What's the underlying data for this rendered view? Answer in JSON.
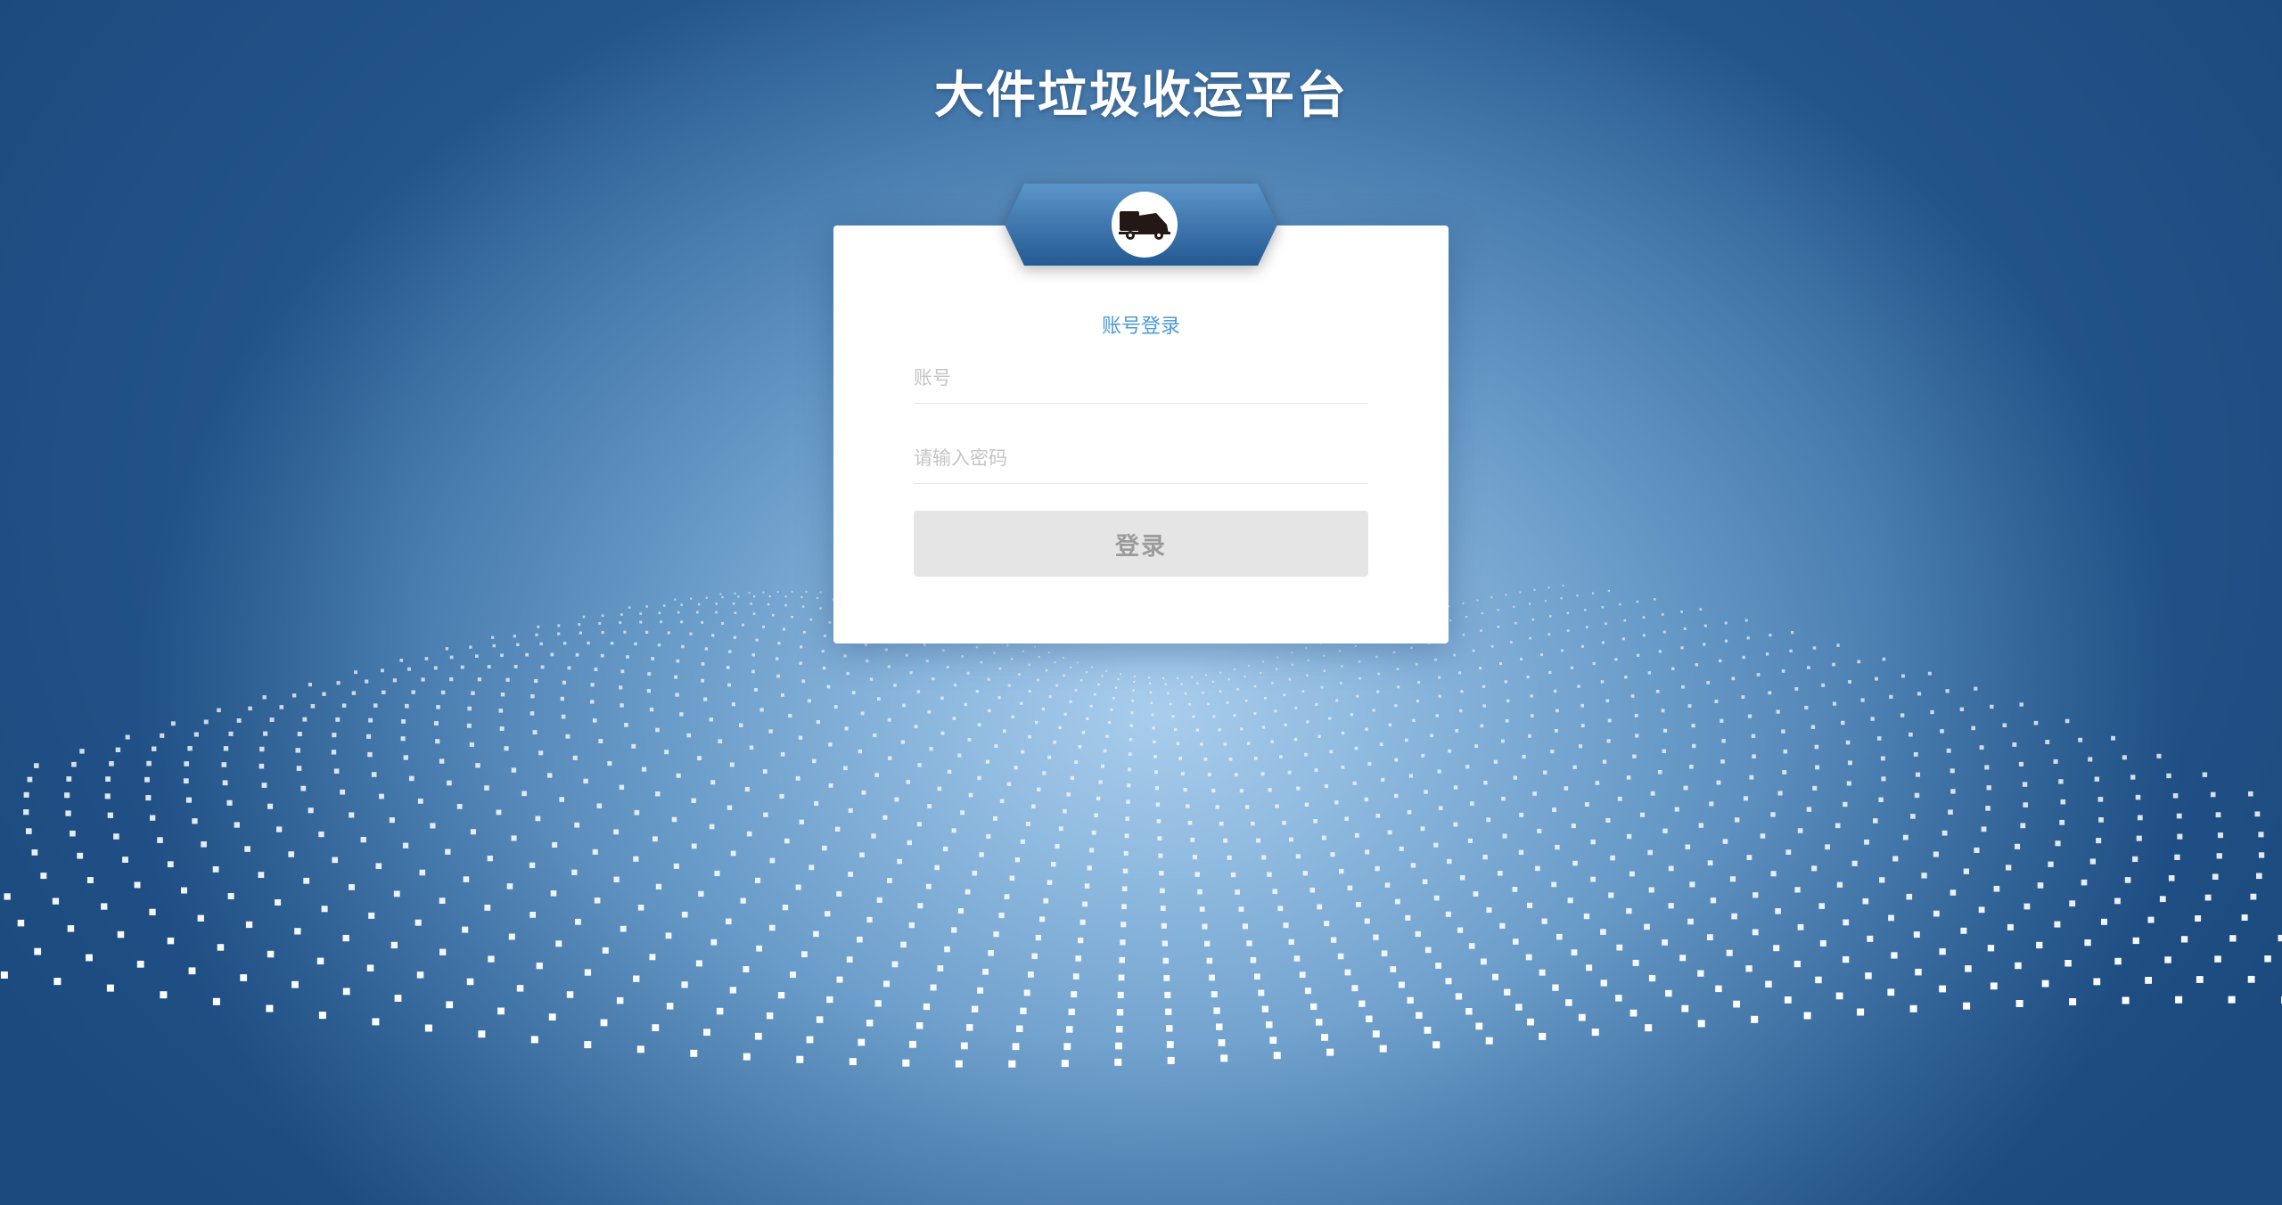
{
  "app": {
    "title": "大件垃圾收运平台"
  },
  "login": {
    "mode_label": "账号登录",
    "account_placeholder": "账号",
    "password_placeholder": "请输入密码",
    "submit_label": "登录",
    "logo_icon": "garbage-truck-icon"
  },
  "colors": {
    "accent": "#4a9bd9",
    "badge_top": "#4a86be",
    "badge_bottom": "#2a5f97",
    "button_bg": "#e5e5e5",
    "button_text": "#9b9b9b"
  }
}
